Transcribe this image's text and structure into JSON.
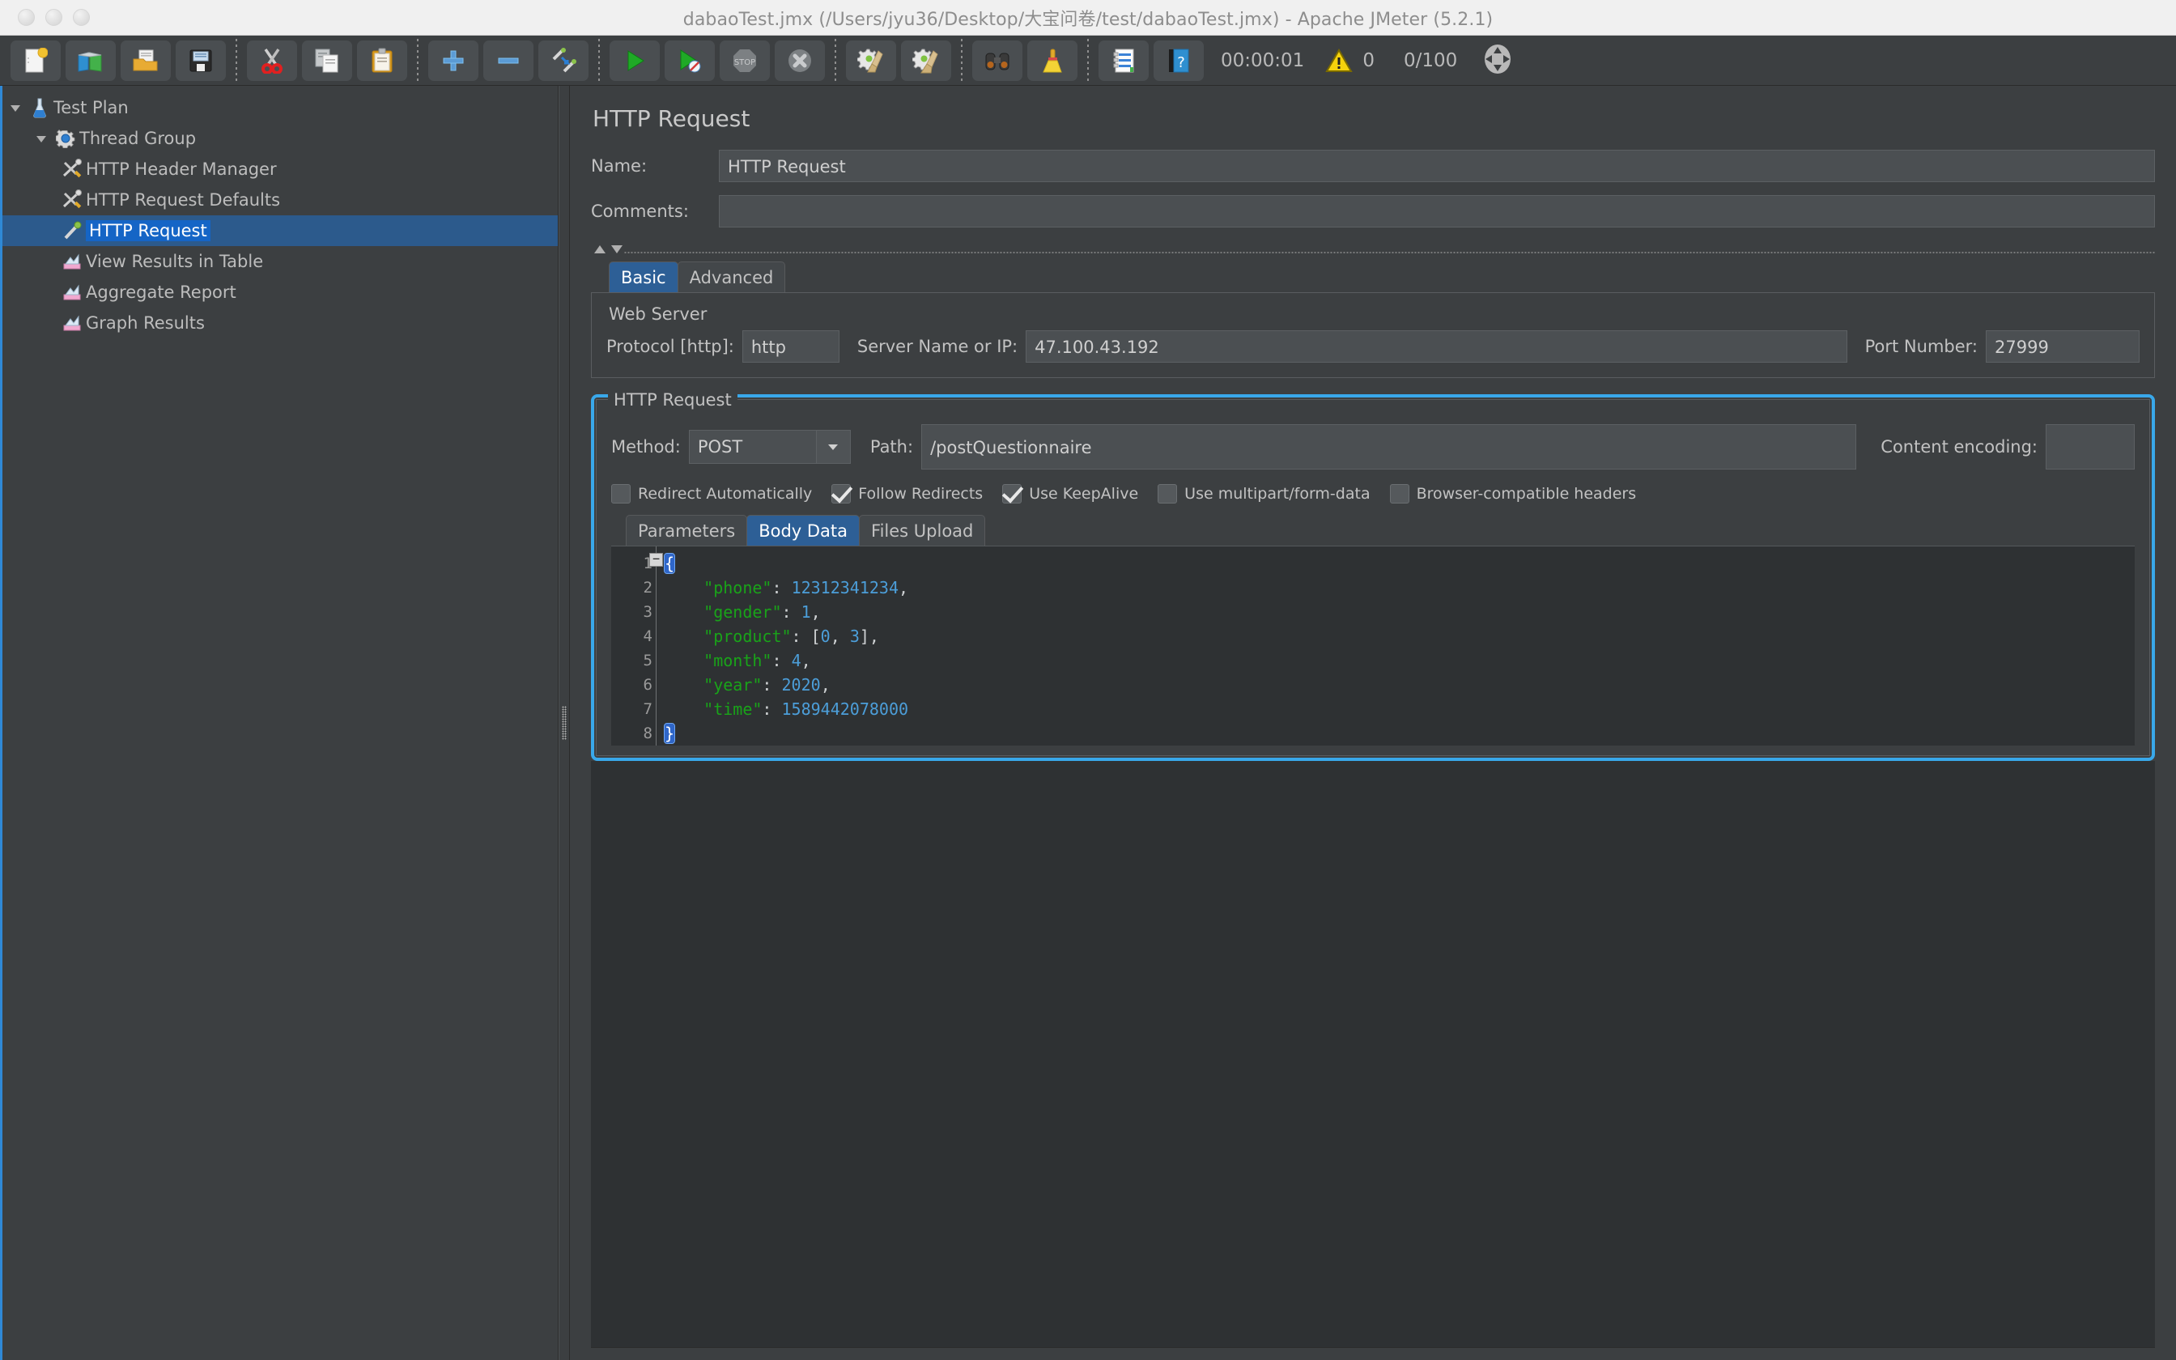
{
  "window": {
    "title": "dabaoTest.jmx (/Users/jyu36/Desktop/大宝问卷/test/dabaoTest.jmx) - Apache JMeter (5.2.1)"
  },
  "toolbar": {
    "buttons": [
      {
        "name": "new-button",
        "icon": "new-document-icon",
        "tooltip": "New"
      },
      {
        "name": "templates-button",
        "icon": "templates-icon",
        "tooltip": "Templates"
      },
      {
        "name": "open-button",
        "icon": "open-folder-icon",
        "tooltip": "Open"
      },
      {
        "name": "save-button",
        "icon": "save-floppy-icon",
        "tooltip": "Save"
      },
      {
        "name": "cut-button",
        "icon": "scissors-icon",
        "tooltip": "Cut"
      },
      {
        "name": "copy-button",
        "icon": "copy-icon",
        "tooltip": "Copy"
      },
      {
        "name": "paste-button",
        "icon": "clipboard-icon",
        "tooltip": "Paste"
      },
      {
        "name": "expand-all-button",
        "icon": "plus-icon",
        "tooltip": "Expand All"
      },
      {
        "name": "collapse-all-button",
        "icon": "minus-icon",
        "tooltip": "Collapse All"
      },
      {
        "name": "toggle-button",
        "icon": "toggle-pencils-icon",
        "tooltip": "Toggle"
      },
      {
        "name": "start-button",
        "icon": "play-icon",
        "tooltip": "Start"
      },
      {
        "name": "start-no-pauses-button",
        "icon": "play-no-timers-icon",
        "tooltip": "Start no pauses"
      },
      {
        "name": "stop-button",
        "icon": "stop-icon",
        "tooltip": "Stop"
      },
      {
        "name": "shutdown-button",
        "icon": "shutdown-icon",
        "tooltip": "Shutdown"
      },
      {
        "name": "clear-button",
        "icon": "gear-broom-icon",
        "tooltip": "Clear"
      },
      {
        "name": "clear-all-button",
        "icon": "gear-broom-all-icon",
        "tooltip": "Clear All"
      },
      {
        "name": "search-button",
        "icon": "binoculars-icon",
        "tooltip": "Search"
      },
      {
        "name": "reset-search-button",
        "icon": "yellow-broom-icon",
        "tooltip": "Reset Search"
      },
      {
        "name": "function-helper-button",
        "icon": "notebook-icon",
        "tooltip": "Function Helper Dialog"
      },
      {
        "name": "help-button",
        "icon": "help-book-icon",
        "tooltip": "Help"
      }
    ],
    "elapsed_time": "00:00:01",
    "warning_count": "0",
    "thread_counter": "0/100"
  },
  "tree": {
    "nodes": [
      {
        "label": "Test Plan",
        "icon": "flask-icon",
        "depth": 0,
        "twisty": "down",
        "selected": false
      },
      {
        "label": "Thread Group",
        "icon": "gear-icon",
        "depth": 1,
        "twisty": "down",
        "selected": false
      },
      {
        "label": "HTTP Header Manager",
        "icon": "wrench-screwdriver-icon",
        "depth": 2,
        "twisty": "none",
        "selected": false
      },
      {
        "label": "HTTP Request Defaults",
        "icon": "wrench-screwdriver-icon",
        "depth": 2,
        "twisty": "none",
        "selected": false
      },
      {
        "label": "HTTP Request",
        "icon": "pencil-icon",
        "depth": 2,
        "twisty": "none",
        "selected": true
      },
      {
        "label": "View Results in Table",
        "icon": "chart-icon",
        "depth": 2,
        "twisty": "none",
        "selected": false
      },
      {
        "label": "Aggregate Report",
        "icon": "chart-icon",
        "depth": 2,
        "twisty": "none",
        "selected": false
      },
      {
        "label": "Graph Results",
        "icon": "chart-icon",
        "depth": 2,
        "twisty": "none",
        "selected": false
      }
    ]
  },
  "main": {
    "panel_title": "HTTP Request",
    "name_label": "Name:",
    "name_value": "HTTP Request",
    "comments_label": "Comments:",
    "comments_value": "",
    "tabs": [
      {
        "label": "Basic",
        "active": true
      },
      {
        "label": "Advanced",
        "active": false
      }
    ],
    "web_server": {
      "group_title": "Web Server",
      "protocol_label": "Protocol [http]:",
      "protocol_value": "http",
      "server_label": "Server Name or IP:",
      "server_value": "47.100.43.192",
      "port_label": "Port Number:",
      "port_value": "27999"
    },
    "http_request": {
      "group_title": "HTTP Request",
      "method_label": "Method:",
      "method_value": "POST",
      "path_label": "Path:",
      "path_value": "/postQuestionnaire",
      "content_encoding_label": "Content encoding:",
      "content_encoding_value": "",
      "checkboxes": [
        {
          "label": "Redirect Automatically",
          "checked": false
        },
        {
          "label": "Follow Redirects",
          "checked": true
        },
        {
          "label": "Use KeepAlive",
          "checked": true
        },
        {
          "label": "Use multipart/form-data",
          "checked": false
        },
        {
          "label": "Browser-compatible headers",
          "checked": false
        }
      ],
      "editor_tabs": [
        {
          "label": "Parameters",
          "active": false
        },
        {
          "label": "Body Data",
          "active": true
        },
        {
          "label": "Files Upload",
          "active": false
        }
      ],
      "body_data": {
        "lines": [
          {
            "num": "1",
            "segments": [
              {
                "t": "{",
                "c": "brace-hl"
              }
            ]
          },
          {
            "num": "2",
            "segments": [
              {
                "t": "    ",
                "c": "p"
              },
              {
                "t": "\"phone\"",
                "c": "k"
              },
              {
                "t": ": ",
                "c": "p"
              },
              {
                "t": "12312341234",
                "c": "v"
              },
              {
                "t": ",",
                "c": "p"
              }
            ]
          },
          {
            "num": "3",
            "segments": [
              {
                "t": "    ",
                "c": "p"
              },
              {
                "t": "\"gender\"",
                "c": "k"
              },
              {
                "t": ": ",
                "c": "p"
              },
              {
                "t": "1",
                "c": "v"
              },
              {
                "t": ",",
                "c": "p"
              }
            ]
          },
          {
            "num": "4",
            "segments": [
              {
                "t": "    ",
                "c": "p"
              },
              {
                "t": "\"product\"",
                "c": "k"
              },
              {
                "t": ": [",
                "c": "p"
              },
              {
                "t": "0",
                "c": "v"
              },
              {
                "t": ", ",
                "c": "p"
              },
              {
                "t": "3",
                "c": "v"
              },
              {
                "t": "],",
                "c": "p"
              }
            ]
          },
          {
            "num": "5",
            "segments": [
              {
                "t": "    ",
                "c": "p"
              },
              {
                "t": "\"month\"",
                "c": "k"
              },
              {
                "t": ": ",
                "c": "p"
              },
              {
                "t": "4",
                "c": "v"
              },
              {
                "t": ",",
                "c": "p"
              }
            ]
          },
          {
            "num": "6",
            "segments": [
              {
                "t": "    ",
                "c": "p"
              },
              {
                "t": "\"year\"",
                "c": "k"
              },
              {
                "t": ": ",
                "c": "p"
              },
              {
                "t": "2020",
                "c": "v"
              },
              {
                "t": ",",
                "c": "p"
              }
            ]
          },
          {
            "num": "7",
            "segments": [
              {
                "t": "    ",
                "c": "p"
              },
              {
                "t": "\"time\"",
                "c": "k"
              },
              {
                "t": ": ",
                "c": "p"
              },
              {
                "t": "1589442078000",
                "c": "v"
              }
            ]
          },
          {
            "num": "8",
            "segments": [
              {
                "t": "}",
                "c": "brace-hl"
              }
            ]
          }
        ]
      }
    }
  },
  "colors": {
    "accent_blue": "#39a8ea",
    "selection_blue": "#1565c6",
    "panel_bg": "#3c3f41",
    "editor_bg": "#2e3133",
    "json_key_green": "#19a319",
    "json_value_blue": "#4c9ed9"
  }
}
